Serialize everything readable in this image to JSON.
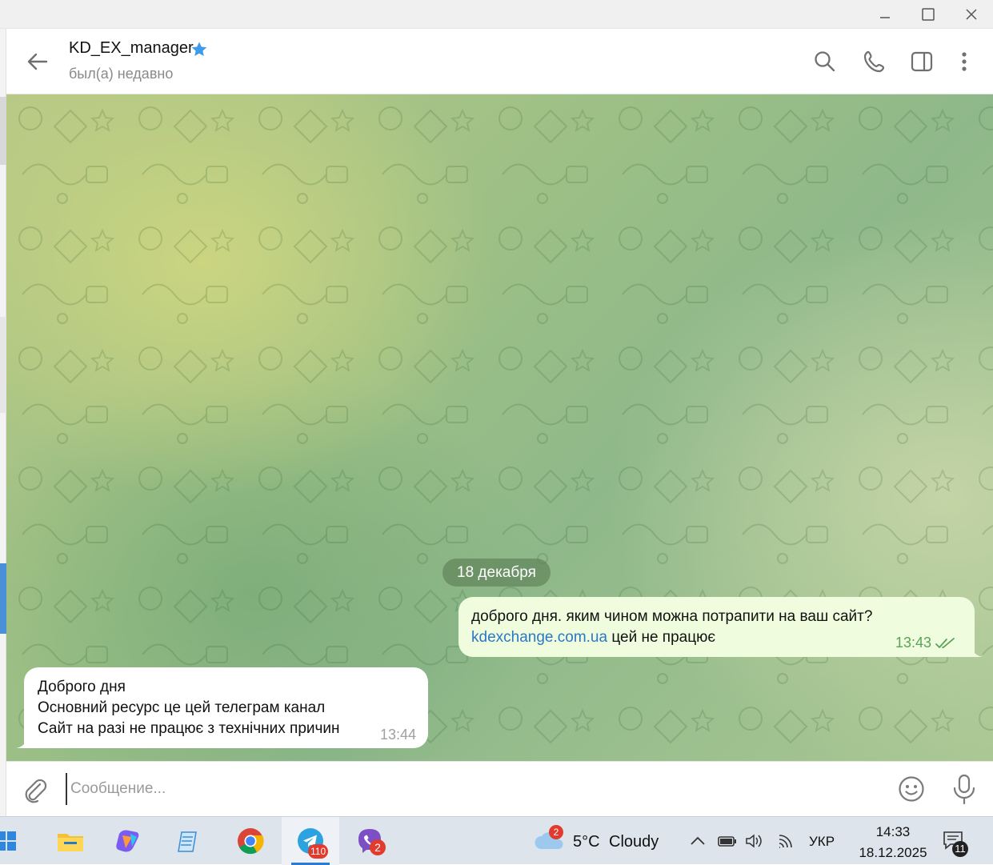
{
  "chat": {
    "contact_name": "KD_EX_manager",
    "contact_status": "был(а) недавно",
    "date_separator": "18 декабря",
    "messages": [
      {
        "direction": "outgoing",
        "line1": "доброго дня. яким чином можна потрапити на ваш сайт?",
        "link": "kdexchange.com.ua",
        "line2_rest": " цей не працює",
        "time": "13:43",
        "status": "read"
      },
      {
        "direction": "incoming",
        "lines": [
          "Доброго дня",
          "Основний ресурс це цей телеграм канал",
          "Сайт на разі не працює з технічних причин"
        ],
        "time": "13:44"
      }
    ],
    "composer_placeholder": "Сообщение..."
  },
  "taskbar": {
    "telegram_badge": "110",
    "viber_badge": "2",
    "weather_badge": "2",
    "weather_temp": "5°C",
    "weather_text": "Cloudy",
    "language": "УКР",
    "time": "14:33",
    "date": "18.12.2025",
    "notifications": "11"
  },
  "icons": {
    "header": [
      "arrow-left-icon",
      "verified-star-icon",
      "search-icon",
      "phone-icon",
      "sidebar-icon",
      "more-vertical-icon"
    ],
    "composer": [
      "paperclip-icon",
      "emoji-icon",
      "microphone-icon"
    ]
  },
  "colors": {
    "accent": "#2a78c4",
    "outgoing_bubble": "#effdde",
    "read_check": "#5aa15a",
    "badge": "#e23a2d"
  }
}
